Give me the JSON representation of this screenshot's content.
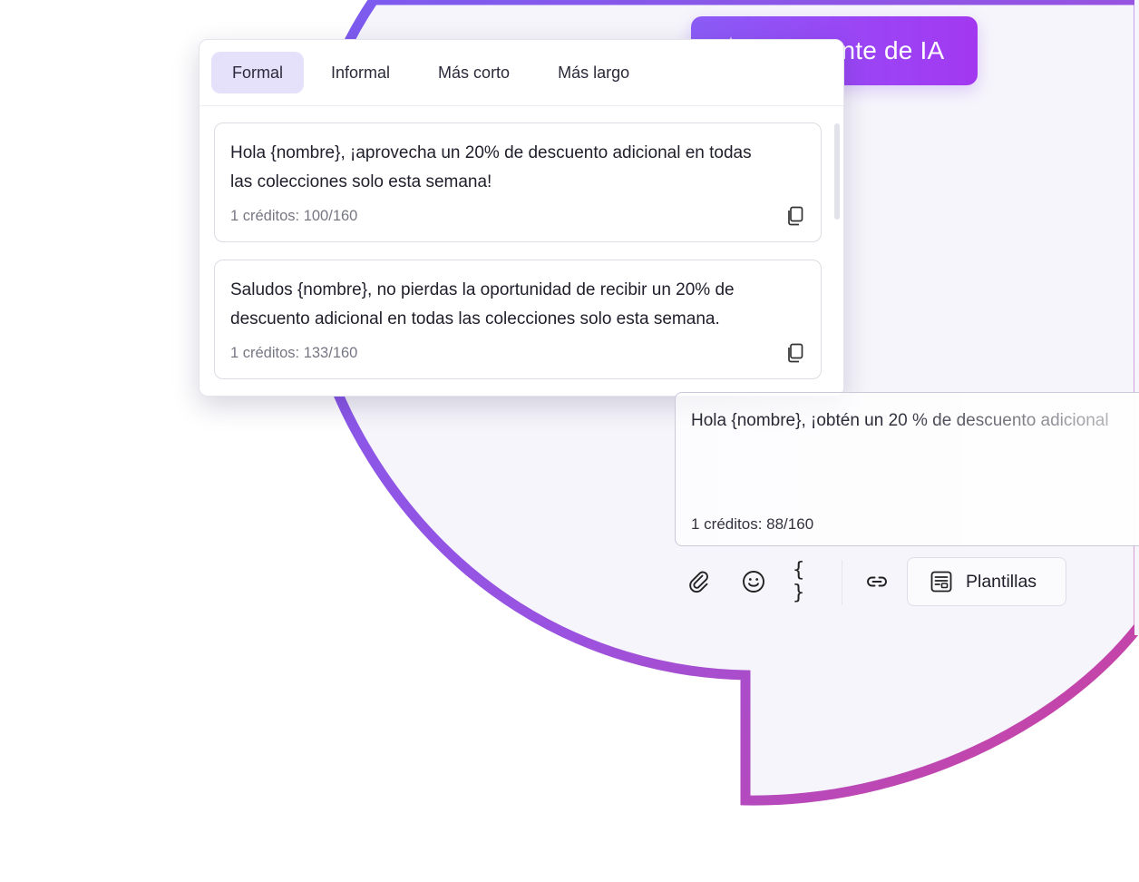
{
  "ai_assistant": {
    "label": "Asistente de IA",
    "icon": "sparkle-icon"
  },
  "tabs": [
    {
      "label": "Formal",
      "active": true
    },
    {
      "label": "Informal",
      "active": false
    },
    {
      "label": "Más corto",
      "active": false
    },
    {
      "label": "Más largo",
      "active": false
    }
  ],
  "suggestions": [
    {
      "text_line1": "Hola {nombre}, ¡aprovecha un 20% de descuento adicional en todas",
      "text_line2": "las colecciones solo esta semana!",
      "credits": "1 créditos: 100/160",
      "icon": "copy-icon"
    },
    {
      "text_line1": "Saludos {nombre}, no pierdas la oportunidad de recibir un 20% de",
      "text_line2": "descuento adicional en todas las colecciones solo esta semana.",
      "credits": "1 créditos: 133/160",
      "icon": "copy-icon"
    }
  ],
  "composer": {
    "text": "Hola {nombre}, ¡obtén un 20 % de descuento adicional",
    "credits": "1 créditos: 88/160"
  },
  "toolbar": {
    "attach_icon": "paperclip-icon",
    "emoji_icon": "smiley-icon",
    "variables_label": "{ }",
    "link_icon": "link-icon",
    "templates_label": "Plantillas",
    "templates_icon": "template-icon"
  },
  "colors": {
    "accent_purple": "#8b5cf6",
    "accent_pink": "#c2479a",
    "tab_active_bg": "#e6e1fb",
    "bubble_fill": "#f6f5fb"
  }
}
